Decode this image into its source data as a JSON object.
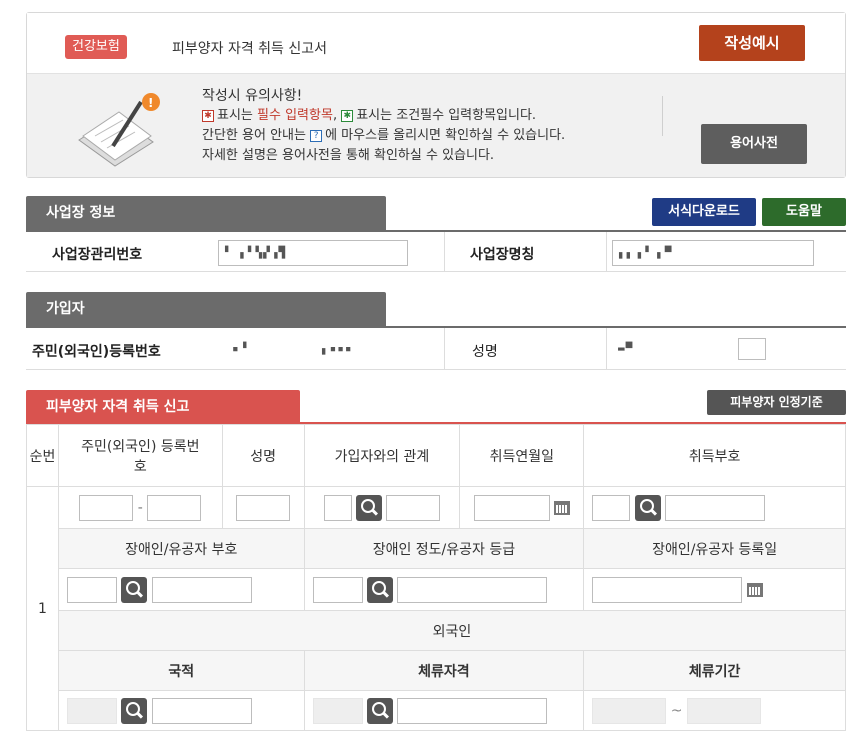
{
  "header": {
    "badge": "건강보험",
    "form_title": "피부양자 자격 취득 신고서",
    "example_button": "작성예시",
    "dictionary_button": "용어사전",
    "notes_title": "작성시 유의사항!",
    "note1_a": "표시는",
    "note1_req": "필수 입력항목",
    "note1_b": ",",
    "note1_c": "표시는 조건필수 입력항목입니다.",
    "note2_a": "간단한 용어 안내는",
    "note2_b": "에 마우스를 올리시면 확인하실 수 있습니다.",
    "note3": "자세한 설명은 용어사전을 통해 확인하실 수 있습니다."
  },
  "workplace": {
    "tab": "사업장 정보",
    "download_button": "서식다운로드",
    "help_button": "도움말",
    "mgmt_no_label": "사업장관리번호",
    "mgmt_no_value": "▘ ▖▘▚▞▗▜",
    "name_label": "사업장명칭",
    "name_value": "▖▖▗▝ ▖▀"
  },
  "subscriber": {
    "tab": "가입자",
    "rrn_label": "주민(외국인)등록번호",
    "rrn_value_a": "▪▝",
    "rrn_value_b": "▖▪▪▪",
    "name_label": "성명",
    "name_value": "▬▀"
  },
  "dependent": {
    "tab": "피부양자 자격 취득 신고",
    "criteria_button": "피부양자 인정기준",
    "col_no": "순번",
    "col_rrn": "주민(외국인) 등록번호",
    "col_name": "성명",
    "col_relation": "가입자와의 관계",
    "col_acq_date": "취득연월일",
    "col_acq_code": "취득부호",
    "row_no": "1",
    "dash": "-",
    "dis_code": "장애인/유공자 부호",
    "dis_grade": "장애인 정도/유공자 등급",
    "dis_reg_date": "장애인/유공자 등록일",
    "foreigner": "외국인",
    "nationality": "국적",
    "stay_status": "체류자격",
    "stay_period": "체류기간",
    "tilde": "~"
  },
  "colors": {
    "badge": "#e05b55",
    "example": "#b4421c",
    "tab_gray": "#6b6b6b",
    "tab_red": "#d9534f",
    "blue_btn": "#1f3b85",
    "green_btn": "#2d6b2b"
  }
}
